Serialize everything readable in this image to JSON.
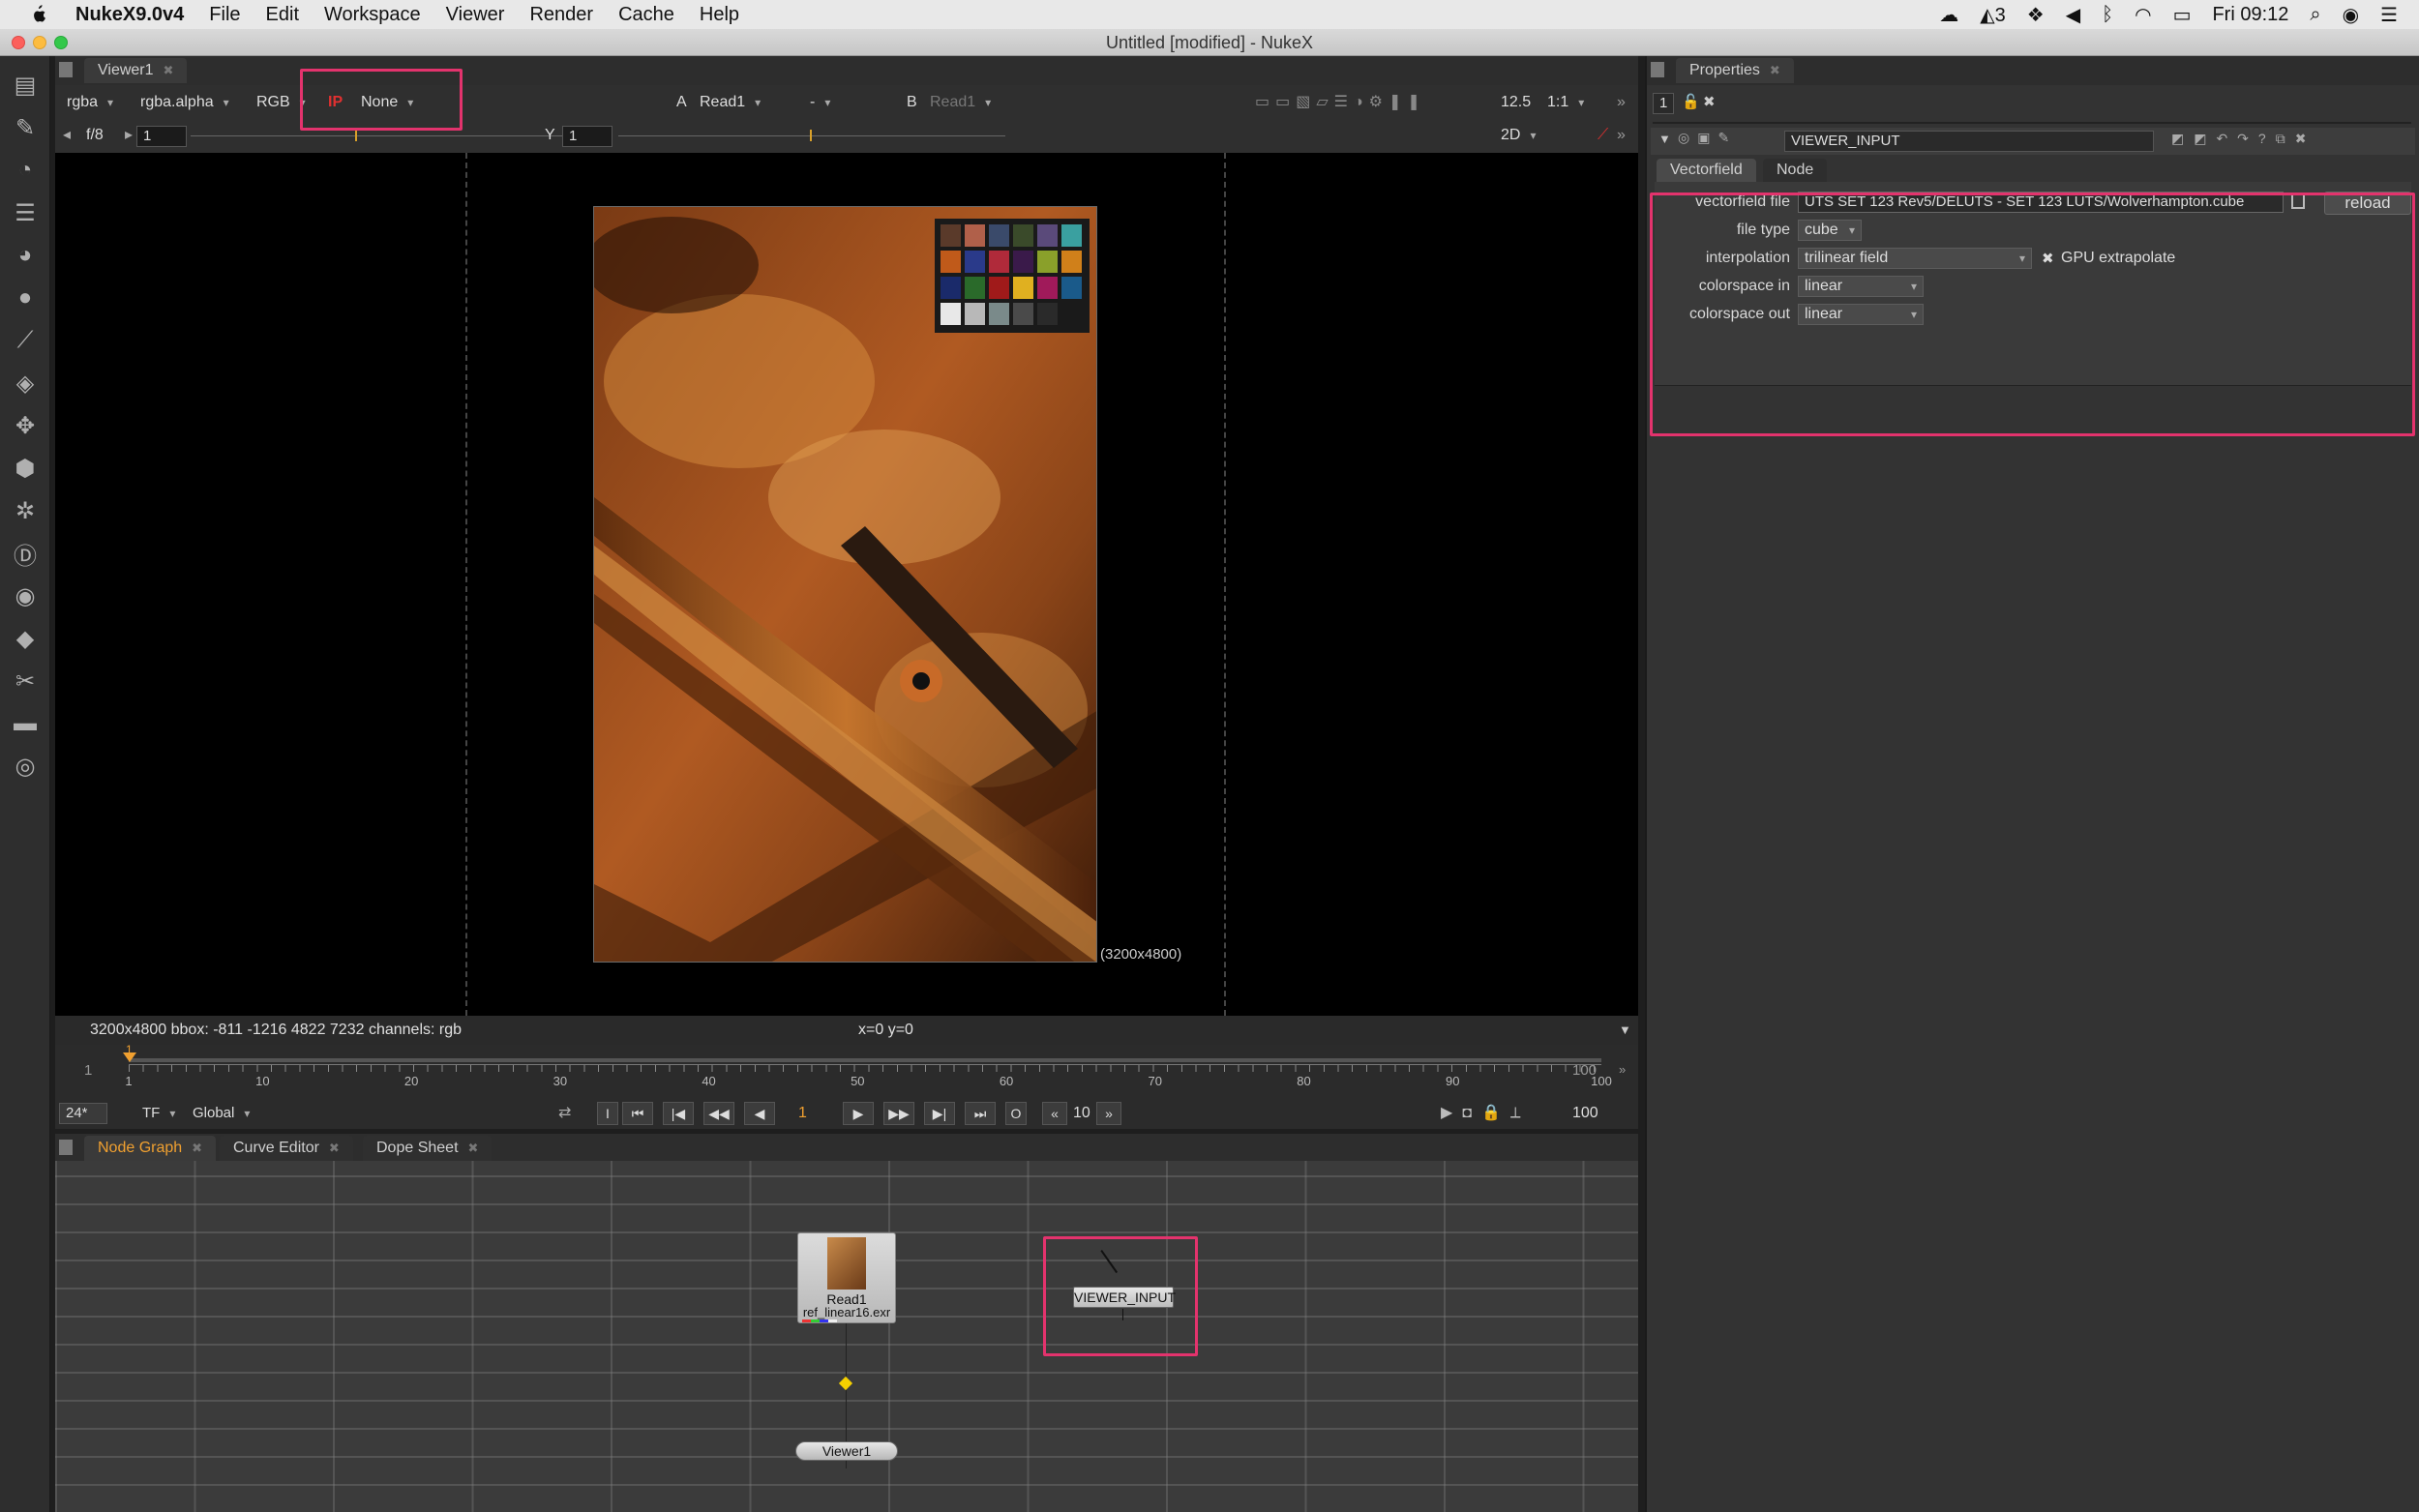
{
  "menubar": {
    "app_name": "NukeX9.0v4",
    "items": [
      "File",
      "Edit",
      "Workspace",
      "Viewer",
      "Render",
      "Cache",
      "Help"
    ],
    "adobe_count": "3",
    "clock": "Fri 09:12"
  },
  "window": {
    "title": "Untitled [modified] - NukeX"
  },
  "viewer_panel": {
    "tab_label": "Viewer1",
    "channels": "rgba",
    "alpha_channel": "rgba.alpha",
    "display": "RGB",
    "ip_label": "IP",
    "input_process": "None",
    "a_label": "A",
    "a_input": "Read1",
    "wipe_mode": "-",
    "b_label": "B",
    "b_input": "Read1",
    "zoom_value": "12.5",
    "ratio": "1:1",
    "fstop": "f/8",
    "gain_value": "1",
    "y_label": "Y",
    "gamma_value": "1",
    "view_mode": "2D",
    "resolution_label": "(3200x4800)",
    "info_text": "3200x4800  bbox: -811 -1216 4822 7232 channels: rgb",
    "coords_text": "x=0 y=0"
  },
  "timeline": {
    "start_frame": "1",
    "end_frame": "100",
    "ticks": [
      "1",
      "10",
      "20",
      "30",
      "40",
      "50",
      "60",
      "70",
      "80",
      "90",
      "100"
    ],
    "current_marker": "1",
    "fps": "24*",
    "tf": "TF",
    "scope": "Global",
    "current_frame": "1",
    "step": "10",
    "end_out": "100"
  },
  "bottom_tabs": [
    {
      "label": "Node Graph",
      "active": true
    },
    {
      "label": "Curve Editor",
      "active": false
    },
    {
      "label": "Dope Sheet",
      "active": false
    }
  ],
  "nodes": {
    "read_name": "Read1",
    "read_file": "ref_linear16.exr",
    "viewer_input": "VIEWER_INPUT",
    "viewer": "Viewer1"
  },
  "properties": {
    "tab_label": "Properties",
    "node_count": "1",
    "node_name": "VIEWER_INPUT",
    "tabs": [
      "Vectorfield",
      "Node"
    ],
    "vectorfield_file_label": "vectorfield file",
    "vectorfield_file": "UTS SET 123 Rev5/DELUTS - SET 123 LUTS/Wolverhampton.cube",
    "reload_label": "reload",
    "file_type_label": "file type",
    "file_type": "cube",
    "interpolation_label": "interpolation",
    "interpolation": "trilinear field",
    "gpu_label": "GPU extrapolate",
    "gpu_checked": true,
    "colorspace_in_label": "colorspace in",
    "colorspace_in": "linear",
    "colorspace_out_label": "colorspace out",
    "colorspace_out": "linear"
  },
  "colors": {
    "highlight": "#e3336d",
    "active_tab_text": "#f0a030",
    "viewer_bg": "#000000",
    "graph_bg": "#3b3b3b"
  }
}
